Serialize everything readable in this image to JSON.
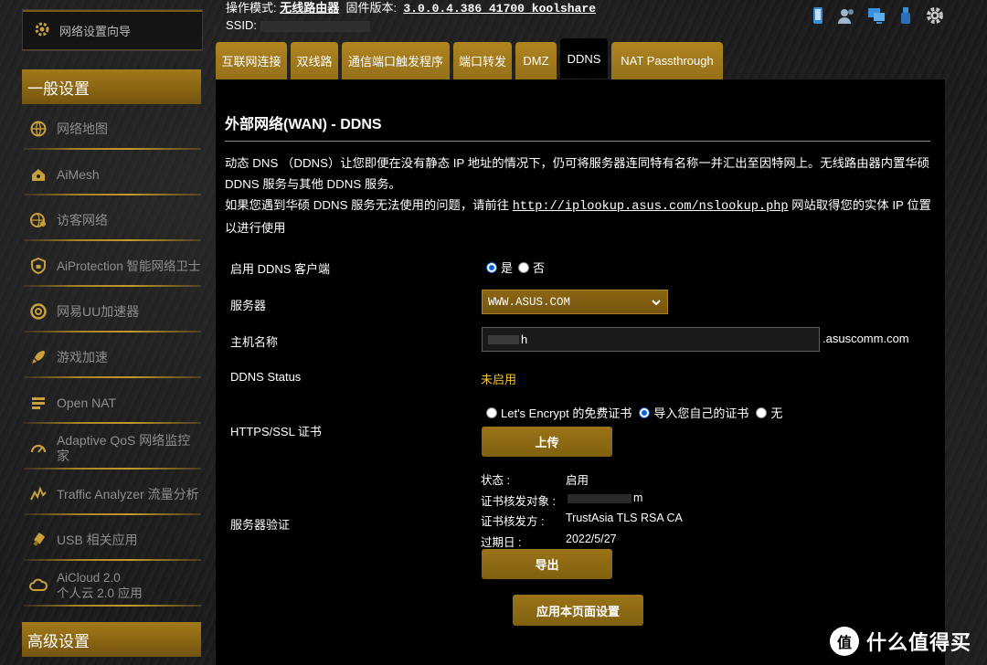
{
  "sidebar": {
    "wizard_label": "网络设置向导",
    "general_header": "一般设置",
    "advanced_header": "高级设置",
    "items": [
      {
        "label": "网络地图",
        "icon": "globe-icon"
      },
      {
        "label": "AiMesh",
        "icon": "mesh-house-icon"
      },
      {
        "label": "访客网络",
        "icon": "guest-globe-icon"
      },
      {
        "label": "AiProtection 智能网络卫士",
        "icon": "shield-lock-icon"
      },
      {
        "label": "网易UU加速器",
        "icon": "uu-accelerator-icon"
      },
      {
        "label": "游戏加速",
        "icon": "rocket-icon"
      },
      {
        "label": "Open NAT",
        "icon": "open-nat-icon"
      },
      {
        "label": "Adaptive QoS 网络监控家",
        "icon": "gauge-icon"
      },
      {
        "label": "Traffic Analyzer 流量分析",
        "icon": "traffic-analyzer-icon"
      },
      {
        "label": "USB 相关应用",
        "icon": "usb-icon"
      },
      {
        "label": "AiCloud 2.0",
        "sub": "个人云 2.0 应用",
        "icon": "cloud-icon"
      }
    ]
  },
  "top_info": {
    "mode_label": "操作模式:",
    "mode_value": "无线路由器",
    "firmware_label": "固件版本:",
    "firmware_value": "3.0.0.4.386_41700_koolshare",
    "ssid_label": "SSID:"
  },
  "tabs": [
    "互联网连接",
    "双线路",
    "通信端口触发程序",
    "端口转发",
    "DMZ",
    "DDNS",
    "NAT Passthrough"
  ],
  "active_tab": "DDNS",
  "panel": {
    "title": "外部网络(WAN) - DDNS",
    "desc_1": "动态 DNS （DDNS）让您即便在没有静态 IP 地址的情况下，仍可将服务器连同特有名称一并汇出至因特网上。无线路由器内置华硕 DDNS 服务与其他 DDNS 服务。",
    "desc_2_prefix": "如果您遇到华硕 DDNS 服务无法使用的问题，请前往",
    "desc_2_link": "http://iplookup.asus.com/nslookup.php",
    "desc_2_suffix": "网站取得您的实体 IP 位置以进行使用"
  },
  "form": {
    "enable_label": "启用 DDNS 客户端",
    "enable_yes": "是",
    "enable_no": "否",
    "server_label": "服务器",
    "server_value": "WWW.ASUS.COM",
    "host_label": "主机名称",
    "host_value": "h",
    "host_suffix": ".asuscomm.com",
    "status_label": "DDNS Status",
    "status_value": "未启用",
    "ssl_label": "HTTPS/SSL 证书",
    "ssl_opt1": "Let's Encrypt 的免费证书",
    "ssl_opt2": "导入您自己的证书",
    "ssl_opt3": "无",
    "upload_btn": "上传",
    "verify_label": "服务器验证",
    "state_key": "状态 :",
    "state_val": "启用",
    "issued_to_key": "证书核发对象 :",
    "issued_to_val_tail": "m",
    "issuer_key": "证书核发方 :",
    "issuer_val": "TrustAsia TLS RSA CA",
    "expire_key": "过期日 :",
    "expire_val": "2022/5/27",
    "export_btn": "导出",
    "apply_btn": "应用本页面设置"
  },
  "watermark": {
    "text": "什么值得买",
    "logo_text": "值"
  },
  "colors": {
    "accent_gold": "#94701a",
    "status_yellow": "#f4c430",
    "panel_bg": "#000000"
  }
}
